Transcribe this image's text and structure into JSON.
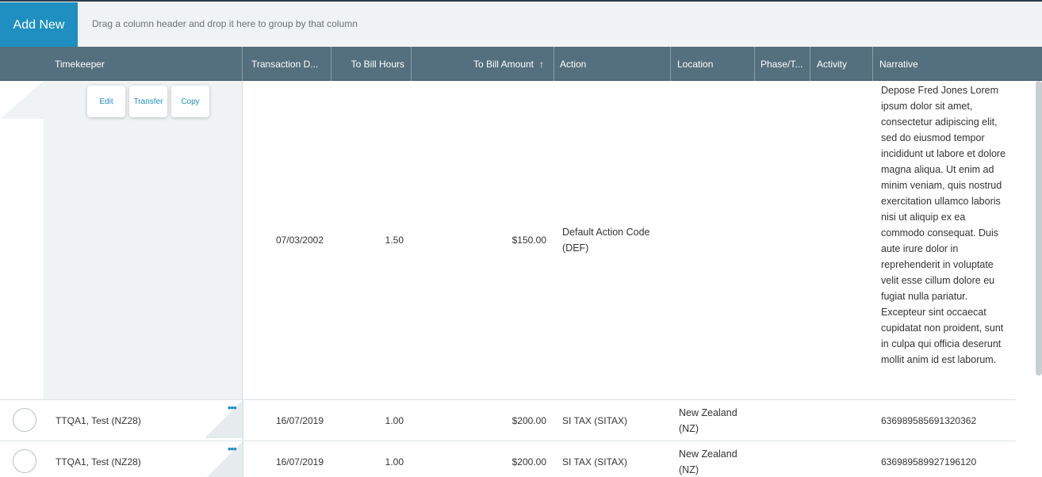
{
  "toolbar": {
    "add_new_label": "Add New",
    "group_hint": "Drag a column header and drop it here to group by that column"
  },
  "columns": {
    "timekeeper": "Timekeeper",
    "transaction_date": "Transaction D...",
    "to_bill_hours": "To Bill Hours",
    "to_bill_amount": "To Bill Amount",
    "action": "Action",
    "location": "Location",
    "phase": "Phase/T...",
    "activity": "Activity",
    "narrative": "Narrative"
  },
  "sort": {
    "column": "to_bill_amount",
    "direction": "ascending",
    "icon": "arrow-up-icon"
  },
  "row_actions": {
    "edit": "Edit",
    "transfer": "Transfer",
    "copy": "Copy"
  },
  "rows": [
    {
      "timekeeper": "",
      "transaction_date": "07/03/2002",
      "to_bill_hours": "1.50",
      "to_bill_amount": "$150.00",
      "action": "Default Action Code (DEF)",
      "location": "",
      "phase": "",
      "activity": "",
      "narrative": "Depose Fred Jones Lorem ipsum dolor sit amet, consectetur adipiscing elit, sed do eiusmod tempor incididunt ut labore et dolore magna aliqua. Ut enim ad minim veniam, quis nostrud exercitation ullamco laboris nisi ut aliquip ex ea commodo consequat. Duis aute irure dolor in reprehenderit in voluptate velit esse cillum dolore eu fugiat nulla pariatur. Excepteur sint occaecat cupidatat non proident, sunt in culpa qui officia deserunt mollit anim id est laborum."
    },
    {
      "timekeeper": "TTQA1, Test (NZ28)",
      "transaction_date": "16/07/2019",
      "to_bill_hours": "1.00",
      "to_bill_amount": "$200.00",
      "action": "SI TAX (SITAX)",
      "location": "New Zealand (NZ)",
      "phase": "",
      "activity": "",
      "narrative": "636989585691320362"
    },
    {
      "timekeeper": "TTQA1, Test (NZ28)",
      "transaction_date": "16/07/2019",
      "to_bill_hours": "1.00",
      "to_bill_amount": "$200.00",
      "action": "SI TAX (SITAX)",
      "location": "New Zealand (NZ)",
      "phase": "",
      "activity": "",
      "narrative": "636989589927196120"
    }
  ],
  "icons": {
    "more": "more-horizontal-icon",
    "sort": "arrow-up-icon"
  },
  "colors": {
    "accent": "#1e8fc0",
    "header": "#546f7d",
    "toolbar": "#f0f3f4"
  }
}
